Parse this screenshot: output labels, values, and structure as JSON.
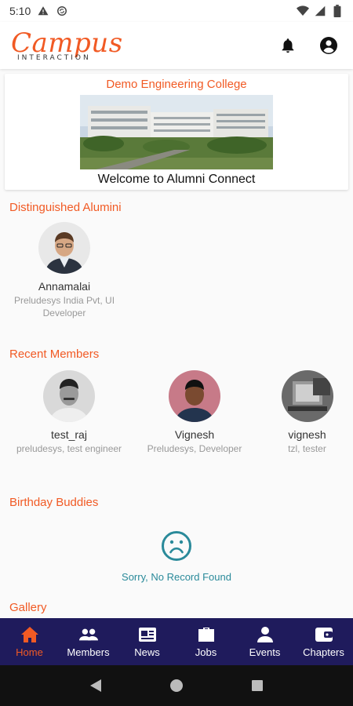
{
  "status_bar": {
    "time": "5:10",
    "icons": [
      "alert-icon",
      "sync-icon",
      "wifi-icon",
      "signal-icon",
      "battery-icon"
    ]
  },
  "app_bar": {
    "logo_main": "Campus",
    "logo_sub": "INTERACTION",
    "icons": [
      "bell-icon",
      "account-icon"
    ]
  },
  "college": {
    "name": "Demo Engineering College",
    "welcome": "Welcome to Alumni Connect"
  },
  "sections": {
    "distinguished": "Distinguished Alumini",
    "recent": "Recent Members",
    "birthday": "Birthday Buddies",
    "gallery": "Gallery"
  },
  "distinguished_alumni": [
    {
      "name": "Annamalai",
      "detail": "Preludesys India Pvt, UI Developer"
    }
  ],
  "recent_members": [
    {
      "name": "test_raj",
      "detail": "preludesys, test engineer"
    },
    {
      "name": "Vignesh",
      "detail": "Preludesys, Developer"
    },
    {
      "name": "vignesh",
      "detail": "tzl, tester"
    }
  ],
  "birthday": {
    "empty_text": "Sorry, No Record Found",
    "icon": "sad-face-icon"
  },
  "bottom_nav": [
    {
      "label": "Home",
      "icon": "home-icon",
      "active": true
    },
    {
      "label": "Members",
      "icon": "group-icon",
      "active": false
    },
    {
      "label": "News",
      "icon": "news-icon",
      "active": false
    },
    {
      "label": "Jobs",
      "icon": "briefcase-icon",
      "active": false
    },
    {
      "label": "Events",
      "icon": "person-icon",
      "active": false
    },
    {
      "label": "Chapters",
      "icon": "wallet-icon",
      "active": false
    }
  ],
  "colors": {
    "accent": "#f15a24",
    "nav_bg": "#1f1b5c",
    "teal": "#2a8a9a"
  }
}
